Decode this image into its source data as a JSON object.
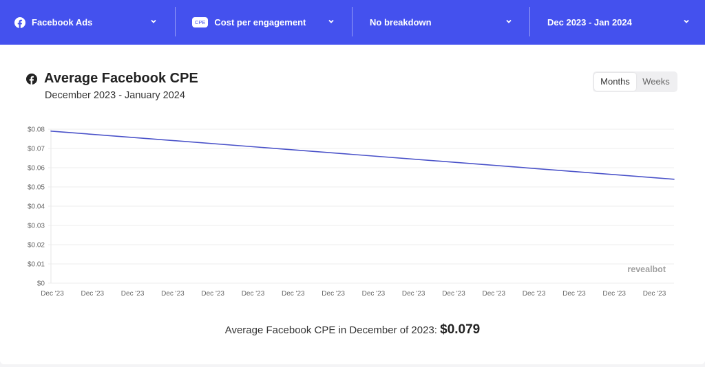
{
  "topbar": {
    "source": {
      "label": "Facebook Ads",
      "icon": "facebook-icon"
    },
    "metric": {
      "badge": "CPE",
      "label": "Cost per engagement"
    },
    "breakdown": {
      "label": "No breakdown"
    },
    "date_range": {
      "label": "Dec 2023 - Jan 2024"
    }
  },
  "card": {
    "title": "Average Facebook CPE",
    "subtitle": "December 2023 - January 2024",
    "toggle": {
      "options": [
        "Months",
        "Weeks"
      ],
      "selected": "Months"
    },
    "watermark": "revealbot",
    "summary_text": "Average Facebook CPE in December of 2023: ",
    "summary_value": "$0.079"
  },
  "colors": {
    "brand": "#4451ee",
    "line": "#4a52c9"
  },
  "chart_data": {
    "type": "line",
    "title": "Average Facebook CPE",
    "xlabel": "",
    "ylabel": "",
    "ylim": [
      0,
      0.08
    ],
    "y_ticks": [
      "$0",
      "$0.01",
      "$0.02",
      "$0.03",
      "$0.04",
      "$0.05",
      "$0.06",
      "$0.07",
      "$0.08"
    ],
    "y_tick_values": [
      0,
      0.01,
      0.02,
      0.03,
      0.04,
      0.05,
      0.06,
      0.07,
      0.08
    ],
    "x_ticks": [
      "Dec '23",
      "Dec '23",
      "Dec '23",
      "Dec '23",
      "Dec '23",
      "Dec '23",
      "Dec '23",
      "Dec '23",
      "Dec '23",
      "Dec '23",
      "Dec '23",
      "Dec '23",
      "Dec '23",
      "Dec '23",
      "Dec '23",
      "Dec '23"
    ],
    "grid": true,
    "legend": "none",
    "series": [
      {
        "name": "Average Facebook CPE",
        "x": [
          "Dec 2023",
          "Jan 2024"
        ],
        "values": [
          0.079,
          0.054
        ]
      }
    ]
  }
}
